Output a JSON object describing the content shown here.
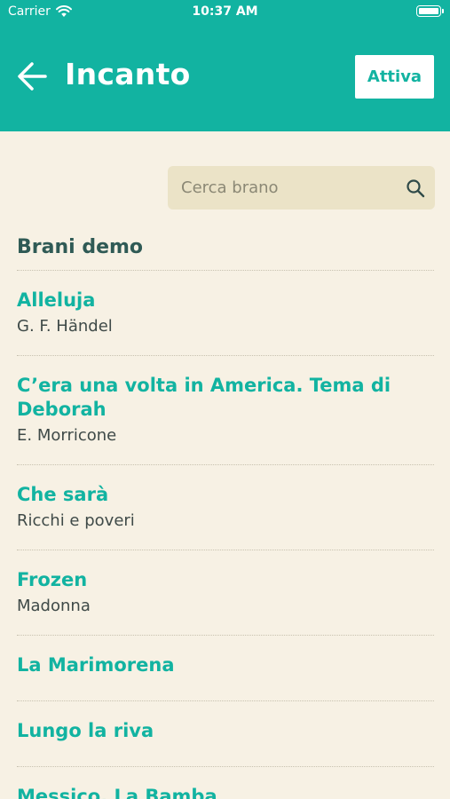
{
  "status_bar": {
    "carrier": "Carrier",
    "time": "10:37 AM"
  },
  "header": {
    "title": "Incanto",
    "activate_label": "Attiva"
  },
  "search": {
    "placeholder": "Cerca brano",
    "value": ""
  },
  "section": {
    "title": "Brani demo"
  },
  "songs": [
    {
      "title": "Alleluja",
      "artist": "G. F. Händel"
    },
    {
      "title": "C’era una volta in America. Tema di Deborah",
      "artist": "E. Morricone"
    },
    {
      "title": "Che sarà",
      "artist": "Ricchi e poveri"
    },
    {
      "title": "Frozen",
      "artist": "Madonna"
    },
    {
      "title": "La Marimorena",
      "artist": ""
    },
    {
      "title": "Lungo la riva",
      "artist": ""
    },
    {
      "title": "Messico. La Bamba",
      "artist": ""
    }
  ],
  "colors": {
    "accent": "#12b3a1",
    "background": "#f7f1e4",
    "search_bg": "#ebe3c7",
    "section_title": "#2f5a55"
  },
  "icons": {
    "back": "arrow-left-icon",
    "search": "search-icon",
    "wifi": "wifi-icon",
    "battery": "battery-icon"
  }
}
